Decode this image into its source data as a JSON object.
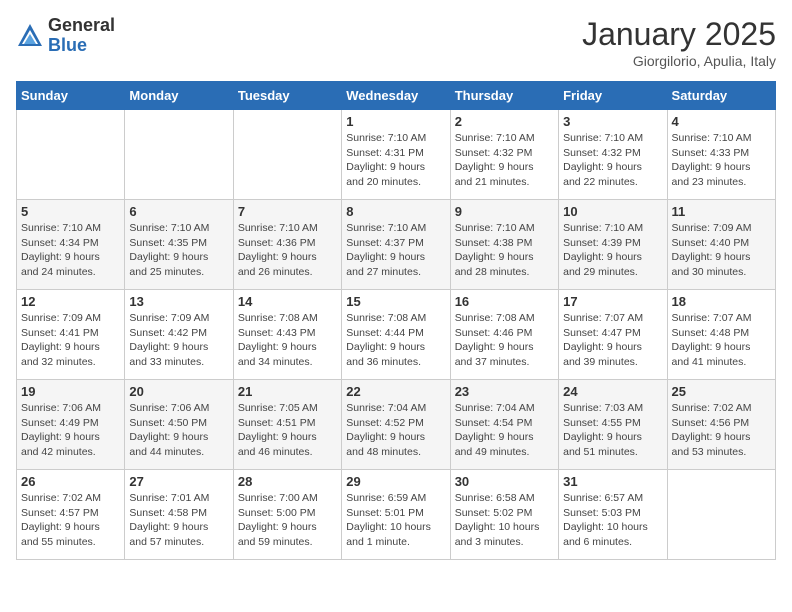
{
  "logo": {
    "general": "General",
    "blue": "Blue"
  },
  "header": {
    "month": "January 2025",
    "location": "Giorgilorio, Apulia, Italy"
  },
  "weekdays": [
    "Sunday",
    "Monday",
    "Tuesday",
    "Wednesday",
    "Thursday",
    "Friday",
    "Saturday"
  ],
  "weeks": [
    [
      {
        "day": "",
        "info": ""
      },
      {
        "day": "",
        "info": ""
      },
      {
        "day": "",
        "info": ""
      },
      {
        "day": "1",
        "info": "Sunrise: 7:10 AM\nSunset: 4:31 PM\nDaylight: 9 hours\nand 20 minutes."
      },
      {
        "day": "2",
        "info": "Sunrise: 7:10 AM\nSunset: 4:32 PM\nDaylight: 9 hours\nand 21 minutes."
      },
      {
        "day": "3",
        "info": "Sunrise: 7:10 AM\nSunset: 4:32 PM\nDaylight: 9 hours\nand 22 minutes."
      },
      {
        "day": "4",
        "info": "Sunrise: 7:10 AM\nSunset: 4:33 PM\nDaylight: 9 hours\nand 23 minutes."
      }
    ],
    [
      {
        "day": "5",
        "info": "Sunrise: 7:10 AM\nSunset: 4:34 PM\nDaylight: 9 hours\nand 24 minutes."
      },
      {
        "day": "6",
        "info": "Sunrise: 7:10 AM\nSunset: 4:35 PM\nDaylight: 9 hours\nand 25 minutes."
      },
      {
        "day": "7",
        "info": "Sunrise: 7:10 AM\nSunset: 4:36 PM\nDaylight: 9 hours\nand 26 minutes."
      },
      {
        "day": "8",
        "info": "Sunrise: 7:10 AM\nSunset: 4:37 PM\nDaylight: 9 hours\nand 27 minutes."
      },
      {
        "day": "9",
        "info": "Sunrise: 7:10 AM\nSunset: 4:38 PM\nDaylight: 9 hours\nand 28 minutes."
      },
      {
        "day": "10",
        "info": "Sunrise: 7:10 AM\nSunset: 4:39 PM\nDaylight: 9 hours\nand 29 minutes."
      },
      {
        "day": "11",
        "info": "Sunrise: 7:09 AM\nSunset: 4:40 PM\nDaylight: 9 hours\nand 30 minutes."
      }
    ],
    [
      {
        "day": "12",
        "info": "Sunrise: 7:09 AM\nSunset: 4:41 PM\nDaylight: 9 hours\nand 32 minutes."
      },
      {
        "day": "13",
        "info": "Sunrise: 7:09 AM\nSunset: 4:42 PM\nDaylight: 9 hours\nand 33 minutes."
      },
      {
        "day": "14",
        "info": "Sunrise: 7:08 AM\nSunset: 4:43 PM\nDaylight: 9 hours\nand 34 minutes."
      },
      {
        "day": "15",
        "info": "Sunrise: 7:08 AM\nSunset: 4:44 PM\nDaylight: 9 hours\nand 36 minutes."
      },
      {
        "day": "16",
        "info": "Sunrise: 7:08 AM\nSunset: 4:46 PM\nDaylight: 9 hours\nand 37 minutes."
      },
      {
        "day": "17",
        "info": "Sunrise: 7:07 AM\nSunset: 4:47 PM\nDaylight: 9 hours\nand 39 minutes."
      },
      {
        "day": "18",
        "info": "Sunrise: 7:07 AM\nSunset: 4:48 PM\nDaylight: 9 hours\nand 41 minutes."
      }
    ],
    [
      {
        "day": "19",
        "info": "Sunrise: 7:06 AM\nSunset: 4:49 PM\nDaylight: 9 hours\nand 42 minutes."
      },
      {
        "day": "20",
        "info": "Sunrise: 7:06 AM\nSunset: 4:50 PM\nDaylight: 9 hours\nand 44 minutes."
      },
      {
        "day": "21",
        "info": "Sunrise: 7:05 AM\nSunset: 4:51 PM\nDaylight: 9 hours\nand 46 minutes."
      },
      {
        "day": "22",
        "info": "Sunrise: 7:04 AM\nSunset: 4:52 PM\nDaylight: 9 hours\nand 48 minutes."
      },
      {
        "day": "23",
        "info": "Sunrise: 7:04 AM\nSunset: 4:54 PM\nDaylight: 9 hours\nand 49 minutes."
      },
      {
        "day": "24",
        "info": "Sunrise: 7:03 AM\nSunset: 4:55 PM\nDaylight: 9 hours\nand 51 minutes."
      },
      {
        "day": "25",
        "info": "Sunrise: 7:02 AM\nSunset: 4:56 PM\nDaylight: 9 hours\nand 53 minutes."
      }
    ],
    [
      {
        "day": "26",
        "info": "Sunrise: 7:02 AM\nSunset: 4:57 PM\nDaylight: 9 hours\nand 55 minutes."
      },
      {
        "day": "27",
        "info": "Sunrise: 7:01 AM\nSunset: 4:58 PM\nDaylight: 9 hours\nand 57 minutes."
      },
      {
        "day": "28",
        "info": "Sunrise: 7:00 AM\nSunset: 5:00 PM\nDaylight: 9 hours\nand 59 minutes."
      },
      {
        "day": "29",
        "info": "Sunrise: 6:59 AM\nSunset: 5:01 PM\nDaylight: 10 hours\nand 1 minute."
      },
      {
        "day": "30",
        "info": "Sunrise: 6:58 AM\nSunset: 5:02 PM\nDaylight: 10 hours\nand 3 minutes."
      },
      {
        "day": "31",
        "info": "Sunrise: 6:57 AM\nSunset: 5:03 PM\nDaylight: 10 hours\nand 6 minutes."
      },
      {
        "day": "",
        "info": ""
      }
    ]
  ]
}
